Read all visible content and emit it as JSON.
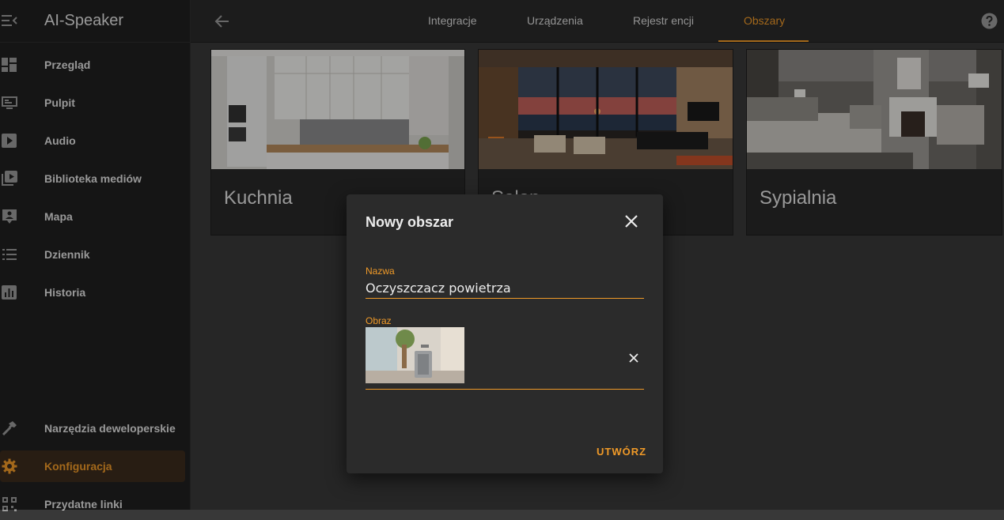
{
  "app": {
    "title": "AI-Speaker"
  },
  "sidebar": {
    "items": [
      {
        "label": "Przegląd",
        "icon": "dashboard-icon"
      },
      {
        "label": "Pulpit",
        "icon": "monitor-icon"
      },
      {
        "label": "Audio",
        "icon": "play-box-icon"
      },
      {
        "label": "Biblioteka mediów",
        "icon": "media-library-icon"
      },
      {
        "label": "Mapa",
        "icon": "map-account-icon"
      },
      {
        "label": "Dziennik",
        "icon": "list-icon"
      },
      {
        "label": "Historia",
        "icon": "chart-box-icon"
      }
    ],
    "bottom_items": [
      {
        "label": "Narzędzia deweloperskie",
        "icon": "hammer-icon"
      },
      {
        "label": "Konfiguracja",
        "icon": "gear-icon",
        "active": true
      },
      {
        "label": "Przydatne linki",
        "icon": "qr-code-icon"
      }
    ]
  },
  "topbar": {
    "tabs": [
      {
        "label": "Integracje"
      },
      {
        "label": "Urządzenia"
      },
      {
        "label": "Rejestr encji"
      },
      {
        "label": "Obszary",
        "active": true
      }
    ]
  },
  "areas": [
    {
      "name": "Kuchnia"
    },
    {
      "name": "Salon"
    },
    {
      "name": "Sypialnia"
    }
  ],
  "dialog": {
    "title": "Nowy obszar",
    "name_label": "Nazwa",
    "name_value": "Oczyszczacz powietrza",
    "image_label": "Obraz",
    "create_label": "UTWÓRZ"
  },
  "colors": {
    "accent": "#f09a28",
    "sidebar_bg": "#1f1f1f",
    "content_bg": "#383838",
    "dialog_bg": "#2b2b2b"
  }
}
